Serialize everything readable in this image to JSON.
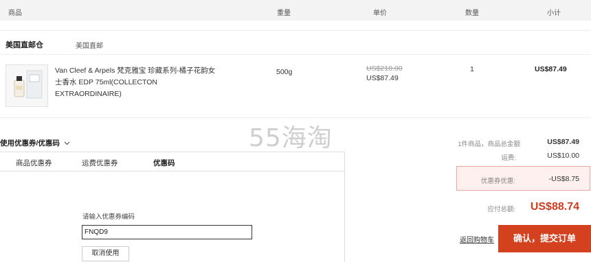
{
  "table_header": {
    "product": "商品",
    "weight": "重量",
    "unit_price": "单价",
    "quantity": "数量",
    "subtotal": "小计"
  },
  "warehouse": {
    "name": "美国直邮仓",
    "tag": "美国直邮"
  },
  "product": {
    "name": "Van Cleef & Arpels 梵克雅宝 珍藏系列-橘子花韵女士香水 EDP 75ml(COLLECTON EXTRAORDINAIRE)",
    "weight": "500g",
    "original_price": "US$210.00",
    "price": "US$87.49",
    "quantity": "1",
    "subtotal": "US$87.49"
  },
  "watermark": "55海淘",
  "coupon": {
    "title": "使用优惠券/优惠码",
    "tabs": [
      "商品优惠券",
      "运费优惠券",
      "优惠码"
    ],
    "active_tab": "优惠码",
    "label": "请输入优惠券编码",
    "code_value": "FNQD9",
    "cancel_label": "取消使用"
  },
  "summary": {
    "items_label": "1件商品，商品总金额",
    "items_value": "US$87.49",
    "shipping_label": "运费:",
    "shipping_value": "US$10.00",
    "discount_label": "优惠券优惠:",
    "discount_value": "-US$8.75",
    "total_label": "应付总额:",
    "total_value": "US$88.74",
    "back_link": "返回购物车",
    "submit_label": "确认，提交订单"
  },
  "colors": {
    "accent": "#d4411f",
    "total_text": "#d23a1c",
    "discount_bg": "#fdf0ee",
    "discount_border": "#e7a8a0"
  }
}
